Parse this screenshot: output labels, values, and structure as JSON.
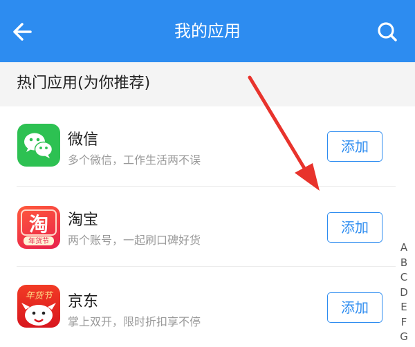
{
  "colors": {
    "brand": "#2d8cf0",
    "arrow": "#e8332c"
  },
  "header": {
    "title": "我的应用",
    "back_icon": "arrow-left-icon",
    "search_icon": "search-icon"
  },
  "section": {
    "title": "热门应用(为你推荐)"
  },
  "apps": [
    {
      "name": "微信",
      "description": "多个微信，工作生活两不误",
      "action": "添加",
      "icon": "wechat-icon"
    },
    {
      "name": "淘宝",
      "description": "两个账号，一起刷口碑好货",
      "action": "添加",
      "icon": "taobao-icon",
      "icon_text": "淘",
      "icon_badge": "年货节"
    },
    {
      "name": "京东",
      "description": "掌上双开，限时折扣享不停",
      "action": "添加",
      "icon": "jd-icon",
      "icon_text": "年货节"
    }
  ],
  "alpha_index": [
    "A",
    "B",
    "C",
    "D",
    "E",
    "F",
    "G"
  ]
}
